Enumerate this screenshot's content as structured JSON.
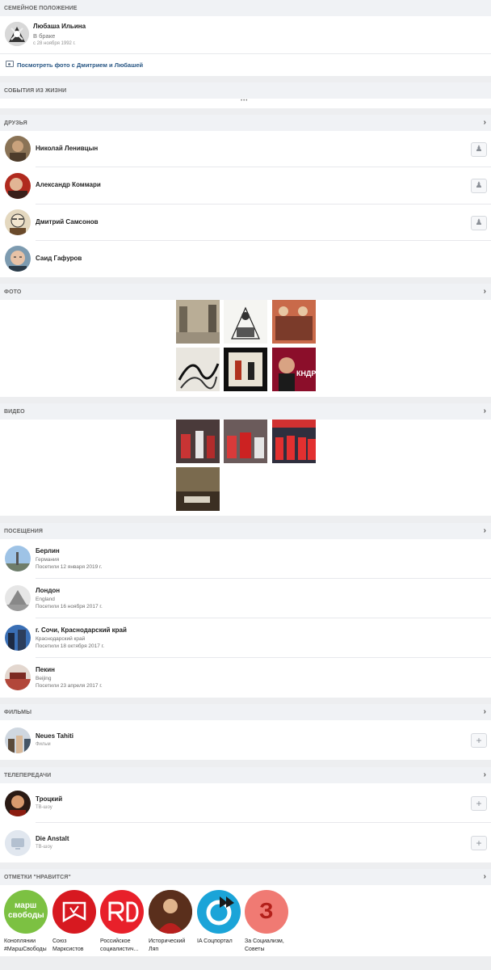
{
  "family": {
    "header": "СЕМЕЙНОЕ ПОЛОЖЕНИЕ",
    "person_name": "Любаша Ильина",
    "status": "В браке",
    "since": "с 28 ноября 1992 г.",
    "photos_link": "Посмотреть фото с Дмитрием и Любашей"
  },
  "life_events": {
    "header": "СОБЫТИЯ ИЗ ЖИЗНИ",
    "more": "•••"
  },
  "friends": {
    "header": "ДРУЗЬЯ",
    "items": [
      {
        "name": "Николай Ленивцын"
      },
      {
        "name": "Александр Коммари"
      },
      {
        "name": "Дмитрий Самсонов"
      },
      {
        "name": "Саид Гафуров"
      }
    ]
  },
  "photos": {
    "header": "ФОТО"
  },
  "videos": {
    "header": "ВИДЕО"
  },
  "photo_text": {
    "poster_caption": "КНДР"
  },
  "visits": {
    "header": "ПОСЕЩЕНИЯ",
    "items": [
      {
        "city": "Берлин",
        "country": "Германия",
        "date": "Посетили 12 января 2019 г."
      },
      {
        "city": "Лондон",
        "country": "England",
        "date": "Посетили 16 ноября 2017 г."
      },
      {
        "city": "г. Сочи, Краснодарский край",
        "country": "Краснодарский край",
        "date": "Посетили 18 октября 2017 г."
      },
      {
        "city": "Пекин",
        "country": "Beijing",
        "date": "Посетили 23 апреля 2017 г."
      }
    ]
  },
  "films": {
    "header": "ФИЛЬМЫ",
    "items": [
      {
        "title": "Neues Tahiti",
        "type": "Фильм"
      }
    ]
  },
  "tv": {
    "header": "ТЕЛЕПЕРЕДАЧИ",
    "items": [
      {
        "title": "Троцкий",
        "type": "ТВ-шоу"
      },
      {
        "title": "Die Anstalt",
        "type": "ТВ-шоу"
      }
    ]
  },
  "likes": {
    "header": "ОТМЕТКИ \"НРАВИТСЯ\"",
    "items": [
      {
        "line1": "Коноплянии",
        "line2": "#МаршСвободы"
      },
      {
        "line1": "Союз",
        "line2": "Марксистов"
      },
      {
        "line1": "Российское",
        "line2": "социалистич..."
      },
      {
        "line1": "Исторический",
        "line2": "Ляп"
      },
      {
        "line1": "IA Соцпортал",
        "line2": ""
      },
      {
        "line1": "За Социализм,",
        "line2": "Советы"
      }
    ],
    "logo1_l1": "марш",
    "logo1_l2": "свободы",
    "logo6": "З"
  },
  "icons": {
    "chevron": "chevron-right-icon",
    "add_friend": "add-friend-icon",
    "add": "plus-icon",
    "photos": "photo-icon"
  },
  "colors": {
    "header_bg": "#f0f2f5",
    "page_bg": "#edeef0",
    "like_green": "#7cc142",
    "like_red": "#d71920",
    "like_teal": "#1ba4d8",
    "like_salmon": "#f07a73"
  }
}
